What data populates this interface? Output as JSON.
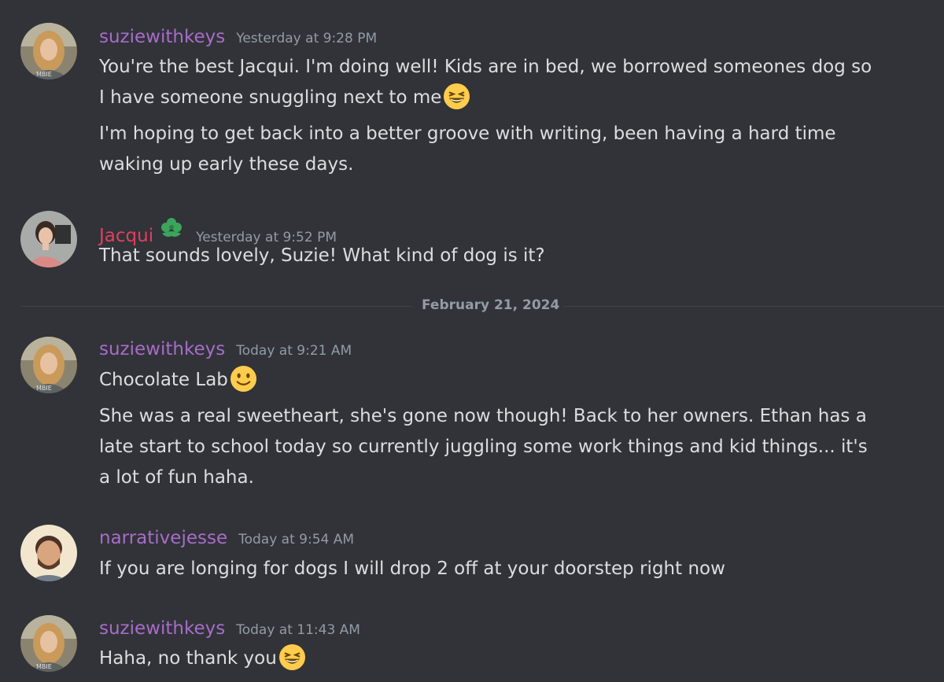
{
  "messages": [
    {
      "author": "suziewithkeys",
      "timestamp": "Yesterday at 9:28 PM",
      "lines": [
        "You're the best Jacqui. I'm doing well! Kids are in bed, we borrowed someones dog so",
        "I have someone snuggling next to me",
        "I'm hoping to get back into a better groove with writing, been having a hard time",
        "waking up early these days."
      ],
      "emoji": "grinning-squinting-face"
    },
    {
      "author": "Jacqui",
      "timestamp": "Yesterday at 9:52 PM",
      "badge_icon": "clover-badge-icon",
      "lines": [
        "That sounds lovely, Suzie! What kind of dog is it?"
      ]
    },
    {
      "author": "suziewithkeys",
      "timestamp": "Today at 9:21 AM",
      "lines": [
        "Chocolate Lab",
        "She was a real sweetheart, she's gone now though! Back to her owners. Ethan has a",
        "late start to school today so currently juggling some work things and kid things... it's",
        "a lot of fun haha."
      ],
      "emoji": "slightly-smiling-face"
    },
    {
      "author": "narrativejesse",
      "timestamp": "Today at 9:54 AM",
      "lines": [
        "If you are longing for dogs I will drop 2 off at your doorstep right now"
      ]
    },
    {
      "author": "suziewithkeys",
      "timestamp": "Today at 11:43 AM",
      "lines": [
        "Haha, no thank you"
      ],
      "emoji": "grinning-squinting-face"
    }
  ],
  "divider": {
    "label": "February 21, 2024"
  },
  "colors": {
    "background": "#313338",
    "text": "#dbdee1",
    "muted": "#949ba4",
    "suzie_name": "#a86cc9",
    "jacqui_name": "#e23f5e",
    "jesse_name": "#a86cc9"
  }
}
